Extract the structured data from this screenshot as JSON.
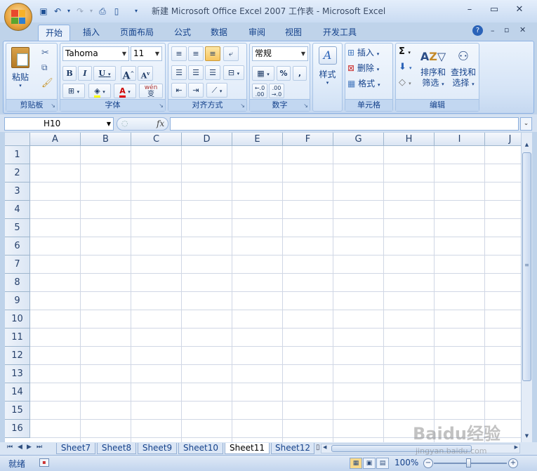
{
  "window": {
    "title": "新建 Microsoft Office Excel 2007 工作表 - Microsoft Excel",
    "minimize": "–",
    "maximize": "▭",
    "close": "✕"
  },
  "qat": {
    "save": "▣",
    "undo": "↶",
    "redo": "↷",
    "dropdown": "▾"
  },
  "tabs": [
    "开始",
    "插入",
    "页面布局",
    "公式",
    "数据",
    "审阅",
    "视图",
    "开发工具"
  ],
  "ribbon": {
    "clipboard": {
      "label": "剪贴板",
      "paste": "粘贴"
    },
    "font": {
      "label": "字体",
      "name": "Tahoma",
      "size": "11",
      "bold": "B",
      "italic": "I",
      "underline": "U",
      "grow": "A",
      "shrink": "A",
      "phonetic": "wén\n变"
    },
    "alignment": {
      "label": "对齐方式"
    },
    "number": {
      "label": "数字",
      "format": "常规",
      "percent": "%",
      "comma": ",",
      "inc": ".0\n.00",
      "dec": ".00\n.0"
    },
    "styles": {
      "label": "样式"
    },
    "cells": {
      "label": "单元格",
      "insert": "插入",
      "delete": "删除",
      "format": "格式"
    },
    "editing": {
      "label": "编辑",
      "sort": "排序和\n筛选",
      "find": "查找和\n选择",
      "sum": "Σ"
    }
  },
  "formula_bar": {
    "name_box": "H10",
    "fx": "fx",
    "value": ""
  },
  "grid": {
    "columns": [
      "A",
      "B",
      "C",
      "D",
      "E",
      "F",
      "G",
      "H",
      "I",
      "J"
    ],
    "rows": [
      "1",
      "2",
      "3",
      "4",
      "5",
      "6",
      "7",
      "8",
      "9",
      "10",
      "11",
      "12",
      "13",
      "14",
      "15",
      "16"
    ]
  },
  "sheets": [
    "Sheet7",
    "Sheet8",
    "Sheet9",
    "Sheet10",
    "Sheet11",
    "Sheet12"
  ],
  "active_sheet": "Sheet11",
  "status": {
    "ready": "就绪",
    "zoom": "100%"
  },
  "watermark": {
    "text": "Baidu经验",
    "url": "jingyan.baidu.com"
  },
  "colors": {
    "accent": "#15428b",
    "ribbon": "#dde9f8",
    "grid_line": "#d0d7e5"
  }
}
